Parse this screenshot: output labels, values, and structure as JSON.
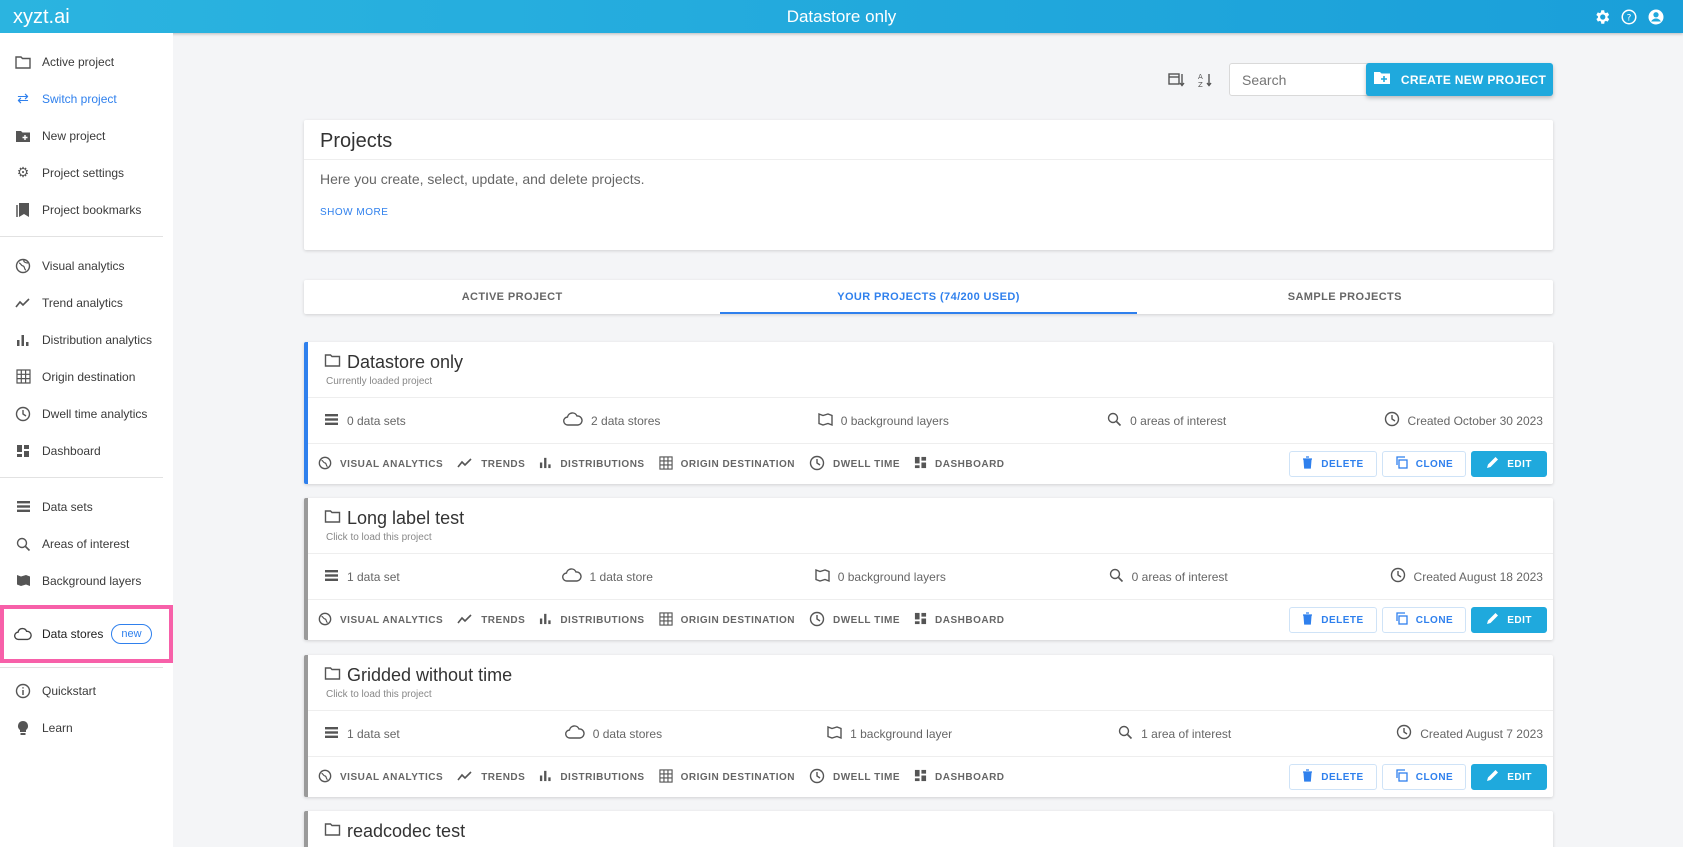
{
  "app": {
    "brand": "xyzt.ai",
    "title": "Datastore only",
    "header_icons": [
      "gear-icon",
      "help-icon",
      "account-icon"
    ]
  },
  "sidebar": {
    "groups": [
      [
        {
          "label": "Active project",
          "icon": "folder-icon"
        },
        {
          "label": "Switch project",
          "icon": "swap-icon",
          "active": true
        },
        {
          "label": "New project",
          "icon": "new-folder-icon"
        },
        {
          "label": "Project settings",
          "icon": "gear-icon"
        },
        {
          "label": "Project bookmarks",
          "icon": "bookmarks-icon"
        }
      ],
      [
        {
          "label": "Visual analytics",
          "icon": "globe-icon"
        },
        {
          "label": "Trend analytics",
          "icon": "trend-icon"
        },
        {
          "label": "Distribution analytics",
          "icon": "bar-chart-icon"
        },
        {
          "label": "Origin destination",
          "icon": "grid-icon"
        },
        {
          "label": "Dwell time analytics",
          "icon": "clock-icon"
        },
        {
          "label": "Dashboard",
          "icon": "dashboard-icon"
        }
      ],
      [
        {
          "label": "Data sets",
          "icon": "list-icon"
        },
        {
          "label": "Areas of interest",
          "icon": "area-search-icon"
        },
        {
          "label": "Background layers",
          "icon": "map-icon"
        },
        {
          "label": "Data stores",
          "icon": "cloud-icon",
          "badge": "new",
          "highlighted": true
        }
      ],
      [
        {
          "label": "Quickstart",
          "icon": "info-icon"
        },
        {
          "label": "Learn",
          "icon": "bulb-icon"
        }
      ]
    ]
  },
  "toolbar": {
    "search_placeholder": "Search",
    "create_label": "CREATE NEW PROJECT"
  },
  "intro": {
    "title": "Projects",
    "description": "Here you create, select, update, and delete projects.",
    "more_label": "SHOW MORE"
  },
  "tabs": [
    {
      "label": "ACTIVE PROJECT"
    },
    {
      "label": "YOUR PROJECTS (74/200 USED)",
      "selected": true
    },
    {
      "label": "SAMPLE PROJECTS"
    }
  ],
  "feature_chips": [
    "VISUAL ANALYTICS",
    "TRENDS",
    "DISTRIBUTIONS",
    "ORIGIN DESTINATION",
    "DWELL TIME",
    "DASHBOARD"
  ],
  "action_labels": {
    "delete": "DELETE",
    "clone": "CLONE",
    "edit": "EDIT"
  },
  "projects": [
    {
      "name": "Datastore only",
      "subtitle": "Currently loaded project",
      "current": true,
      "datasets": "0 data sets",
      "datastores": "2 data stores",
      "layers": "0 background layers",
      "areas": "0 areas of interest",
      "created": "Created October 30 2023"
    },
    {
      "name": "Long label test",
      "subtitle": "Click to load this project",
      "datasets": "1 data set",
      "datastores": "1 data store",
      "layers": "0 background layers",
      "areas": "0 areas of interest",
      "created": "Created August 18 2023"
    },
    {
      "name": "Gridded without time",
      "subtitle": "Click to load this project",
      "datasets": "1 data set",
      "datastores": "0 data stores",
      "layers": "1 background layer",
      "areas": "1 area of interest",
      "created": "Created August 7 2023"
    },
    {
      "name": "readcodec test"
    }
  ]
}
